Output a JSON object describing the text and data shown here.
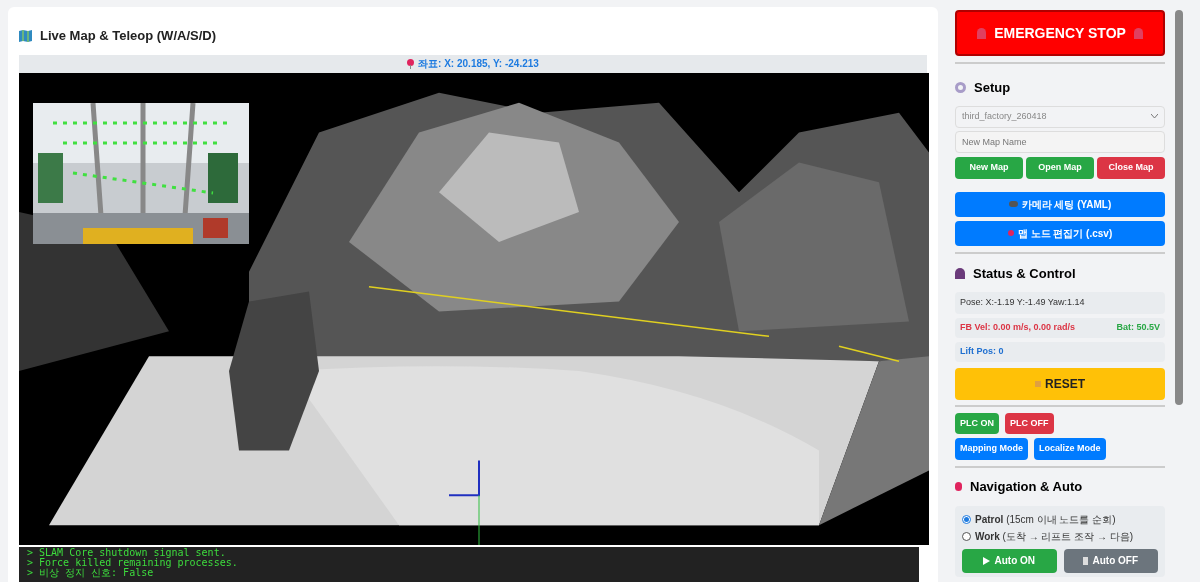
{
  "map_panel": {
    "title": "Live Map & Teleop (W/A/S/D)",
    "coordinates": "좌표: X: 20.185, Y: -24.213",
    "log": [
      "> SLAM Core shutdown signal sent.",
      "> Force killed remaining processes.",
      "> 비상 정지 신호: False"
    ]
  },
  "sidebar": {
    "emergency_button": "EMERGENCY STOP",
    "setup": {
      "title": "Setup",
      "map_select": "third_factory_260418",
      "map_name": {
        "placeholder": "New Map Name"
      },
      "map_buttons": [
        {
          "label": "New Map",
          "kind": "success"
        },
        {
          "label": "Open Map",
          "kind": "success"
        },
        {
          "label": "Close Map",
          "kind": "danger"
        }
      ],
      "tool_buttons": [
        {
          "label": "카메라 세팅 (YAML)",
          "kind": "camera"
        },
        {
          "label": "맵 노드 편집기 (.csv)",
          "kind": "pin"
        }
      ]
    },
    "status": {
      "title": "Status & Control",
      "pose": "Pose: X:-1.19 Y:-1.49 Yaw:1.14",
      "velocity": "FB Vel: 0.00 m/s, 0.00 rad/s",
      "battery": "Bat: 50.5V",
      "lift": "Lift Pos: 0",
      "reset_button": "RESET",
      "plc_buttons": [
        {
          "label": "PLC ON",
          "kind": "success"
        },
        {
          "label": "PLC OFF",
          "kind": "danger"
        }
      ],
      "mode_buttons": [
        {
          "label": "Mapping Mode",
          "kind": "primary"
        },
        {
          "label": "Localize Mode",
          "kind": "primary"
        }
      ]
    },
    "navigation": {
      "title": "Navigation & Auto",
      "modes": [
        {
          "label": "Patrol",
          "note": "(15cm 이내 노드를 순회)",
          "selected": true
        },
        {
          "label": "Work",
          "note": "(도착 → 리프트 조작 → 다음)",
          "selected": false
        }
      ],
      "buttons": [
        {
          "label": "Auto ON",
          "kind": "play"
        },
        {
          "label": "Auto OFF",
          "kind": "stop"
        }
      ]
    }
  }
}
